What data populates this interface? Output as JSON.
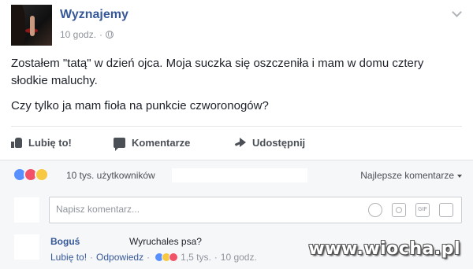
{
  "post": {
    "page_name": "Wyznajemy",
    "time": "10 godz.",
    "separator": "·",
    "text_p1": "Zostałem \"tatą\" w dzień ojca. Moja suczka się oszczeniła i mam w domu cztery słodkie maluchy.",
    "text_p2": "Czy tylko ja mam fioła na punkcie czworonogów?"
  },
  "actions": {
    "like": "Lubię to!",
    "comment": "Komentarze",
    "share": "Udostępnij"
  },
  "reactions": {
    "count": "10 tys. użytkowników",
    "sort": "Najlepsze komentarze",
    "colors": {
      "like": "#5890ff",
      "love": "#f25268",
      "haha": "#f7c842"
    }
  },
  "composer": {
    "placeholder": "Napisz komentarz...",
    "gif": "GIF"
  },
  "comment": {
    "author": "Boguś",
    "text": "Wyruchales psa?",
    "like": "Lubię to!",
    "dot": "·",
    "reply": "Odpowiedz",
    "reactions": "1,5 tys.",
    "time": "10 godz."
  },
  "watermark": "www.wiocha.pl"
}
